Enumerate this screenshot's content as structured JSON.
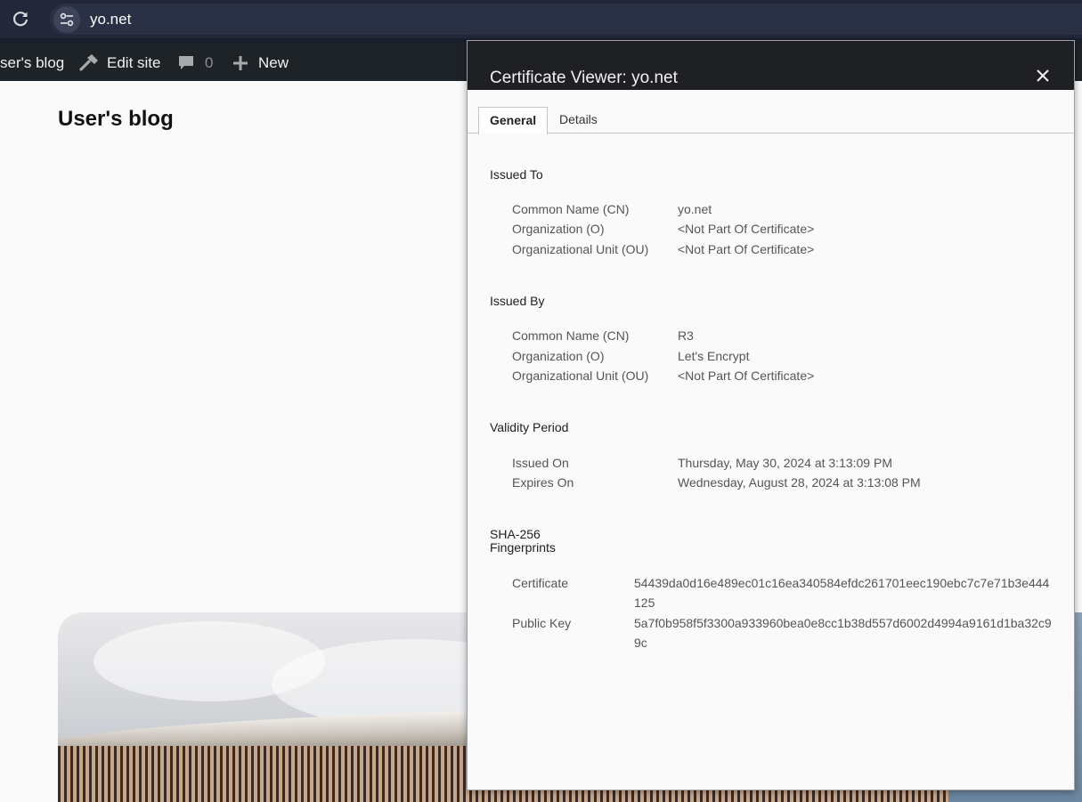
{
  "browser": {
    "url": "yo.net",
    "icons": {
      "reload": "reload-icon",
      "site_info": "tune-icon"
    }
  },
  "admin_bar": {
    "site_name": "ser's blog",
    "edit_site": "Edit site",
    "comments_count": "0",
    "new": "New",
    "icons": {
      "edit": "hammer-icon",
      "comments": "comment-bubble-icon",
      "new": "plus-icon"
    }
  },
  "page": {
    "title": "User's blog"
  },
  "dialog": {
    "title": "Certificate Viewer: yo.net",
    "tabs": [
      "General",
      "Details"
    ],
    "issued_to": {
      "title": "Issued To",
      "rows": [
        {
          "label": "Common Name (CN)",
          "value": "yo.net"
        },
        {
          "label": "Organization (O)",
          "value": "<Not Part Of Certificate>"
        },
        {
          "label": "Organizational Unit (OU)",
          "value": "<Not Part Of Certificate>"
        }
      ]
    },
    "issued_by": {
      "title": "Issued By",
      "rows": [
        {
          "label": "Common Name (CN)",
          "value": "R3"
        },
        {
          "label": "Organization (O)",
          "value": "Let's Encrypt"
        },
        {
          "label": "Organizational Unit (OU)",
          "value": "<Not Part Of Certificate>"
        }
      ]
    },
    "validity": {
      "title": "Validity Period",
      "rows": [
        {
          "label": "Issued On",
          "value": "Thursday, May 30, 2024 at 3:13:09 PM"
        },
        {
          "label": "Expires On",
          "value": "Wednesday, August 28, 2024 at 3:13:08 PM"
        }
      ]
    },
    "fingerprints": {
      "title_line1": "SHA-256",
      "title_line2": "Fingerprints",
      "rows": [
        {
          "label": "Certificate",
          "value": "54439da0d16e489ec01c16ea340584efdc261701eec190ebc7c7e71b3e444125"
        },
        {
          "label": "Public Key",
          "value": "5a7f0b958f5f3300a933960bea0e8cc1b38d557d6002d4994a9161d1ba32c99c"
        }
      ]
    }
  },
  "colors": {
    "browser_bar": "#222739",
    "admin_bar": "#1d2327",
    "dialog_header": "#1f2024",
    "page_bg": "#f9f9f9"
  }
}
